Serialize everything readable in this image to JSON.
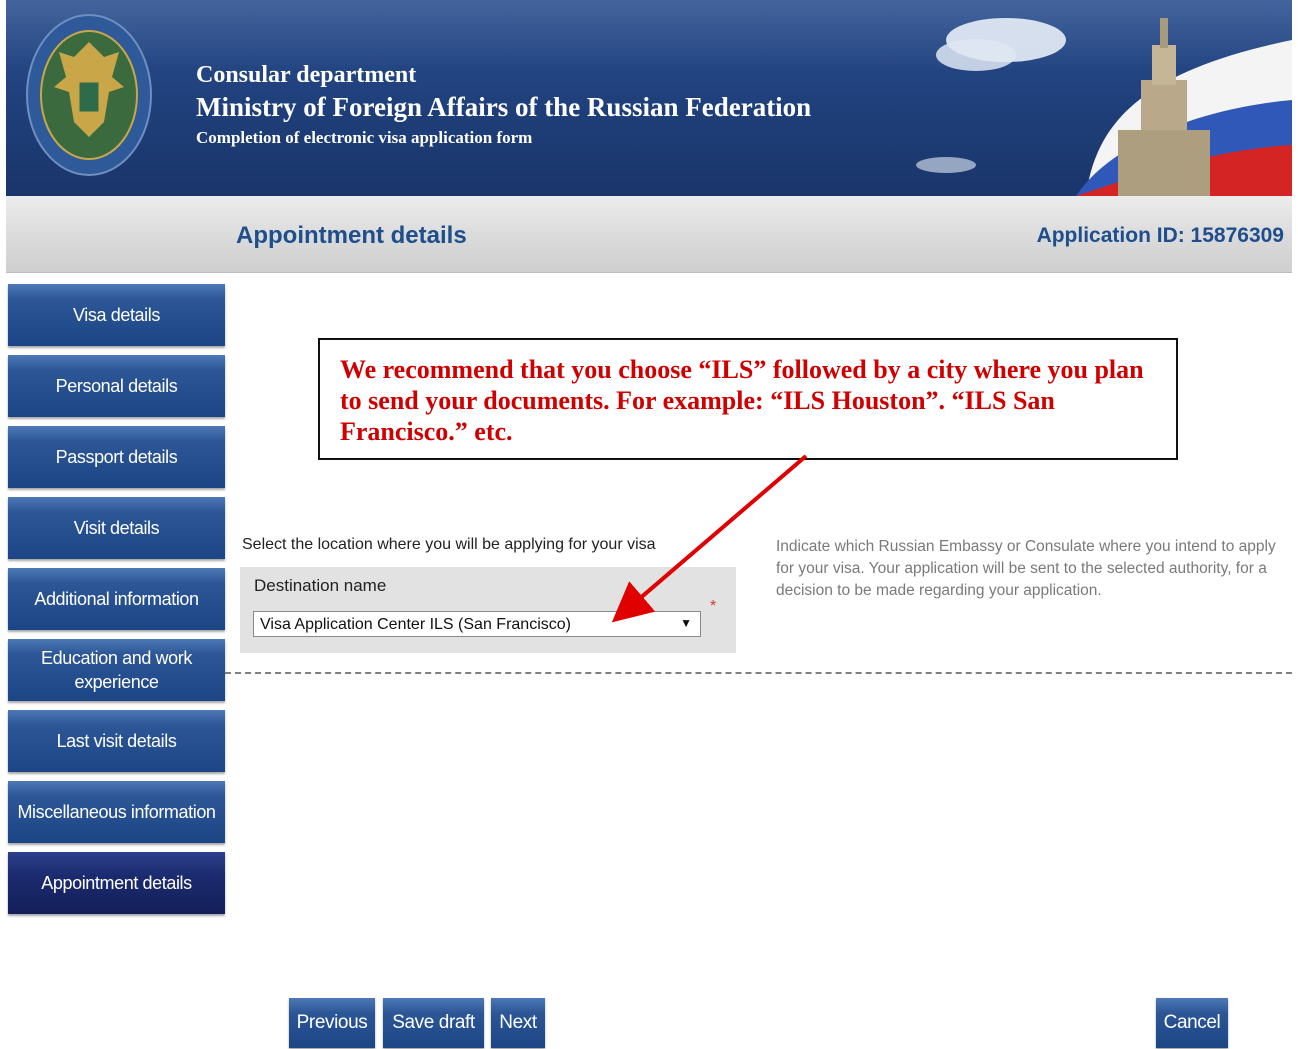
{
  "header": {
    "line1": "Consular department",
    "line2": "Ministry of Foreign Affairs of the Russian Federation",
    "line3": "Completion of electronic visa application form"
  },
  "titlebar": {
    "title": "Appointment details",
    "application_id": "Application ID: 15876309"
  },
  "sidebar": {
    "items": [
      {
        "label": "Visa details",
        "active": false
      },
      {
        "label": "Personal details",
        "active": false
      },
      {
        "label": "Passport details",
        "active": false
      },
      {
        "label": "Visit details",
        "active": false
      },
      {
        "label": "Additional information",
        "active": false
      },
      {
        "label": "Education and work experience",
        "active": false
      },
      {
        "label": "Last visit details",
        "active": false
      },
      {
        "label": "Miscellaneous information",
        "active": false
      },
      {
        "label": "Appointment details",
        "active": true
      }
    ]
  },
  "annotation": {
    "text": "We recommend that you choose “ILS” followed by a city where you plan to send your documents. For example: “ILS Houston”. “ILS San Francisco.” etc."
  },
  "form": {
    "section_label": "Select the location where you will be applying for your visa",
    "field_label": "Destination name",
    "selected_value": "Visa Application Center ILS (San Francisco)",
    "required_mark": "*",
    "help_text": "Indicate which Russian Embassy or Consulate where you intend to apply for your visa. Your application will be sent to the selected authority, for a decision to be made regarding your application."
  },
  "buttons": {
    "previous": "Previous",
    "save_draft": "Save draft",
    "next": "Next",
    "cancel": "Cancel"
  },
  "colors": {
    "header_blue": "#1f3f7a",
    "nav_blue": "#2c5696",
    "nav_active": "#1b2a6e",
    "annotation_red": "#d00000",
    "title_blue": "#1e4f8c"
  }
}
